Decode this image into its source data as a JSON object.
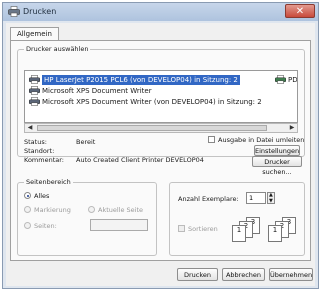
{
  "window": {
    "title": "Drucken",
    "close_glyph": "✕"
  },
  "tabs": [
    {
      "label": "Allgemein"
    }
  ],
  "printer_group": {
    "label": "Drucker auswählen",
    "printers": [
      {
        "label": "HP LaserJet P2015 PCL6 (von DEVELOP04) in Sitzung: 2",
        "icon": "printer-icon",
        "selected": true
      },
      {
        "label": "Microsoft XPS Document Writer",
        "icon": "printer-icon",
        "selected": false
      },
      {
        "label": "Microsoft XPS Document Writer (von DEVELOP04) in Sitzung: 2",
        "icon": "printer-icon",
        "selected": false
      }
    ],
    "right_item_label": "PD",
    "status_label": "Status:",
    "status_value": "Bereit",
    "location_label": "Standort:",
    "location_value": "",
    "comment_label": "Kommentar:",
    "comment_value": "Auto Created Client Printer DEVELOP04",
    "print_to_file_label": "Ausgabe in Datei umleiten",
    "settings_button": "Einstellungen",
    "find_printer_button": "Drucker suchen..."
  },
  "page_range": {
    "label": "Seitenbereich",
    "all_label": "Alles",
    "selection_label": "Markierung",
    "current_page_label": "Aktuelle Seite",
    "pages_label": "Seiten:",
    "pages_value": ""
  },
  "copies": {
    "label": "Anzahl Exemplare:",
    "value": "1",
    "collate_label": "Sortieren",
    "collate_glyph_a": "1",
    "collate_glyph_b": "2",
    "collate_glyph_c": "3"
  },
  "footer": {
    "print_button": "Drucken",
    "cancel_button": "Abbrechen",
    "apply_button": "Übernehmen"
  },
  "colors": {
    "selection": "#3167c4",
    "titlebar": "#aec3de",
    "close_button": "#c84a3b"
  }
}
